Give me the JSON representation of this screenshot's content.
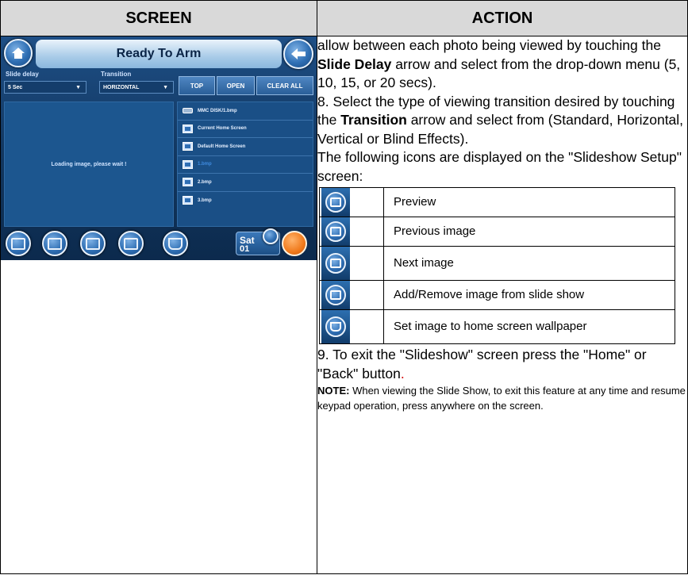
{
  "header": {
    "screen": "SCREEN",
    "action": "ACTION"
  },
  "device": {
    "title": "Ready To Arm",
    "slide_delay_label": "Slide delay",
    "slide_delay_value": "5 Sec",
    "transition_label": "Transition",
    "transition_value": "HORIZONTAL",
    "buttons": {
      "top": "TOP",
      "open": "OPEN",
      "clear_all": "CLEAR ALL"
    },
    "loading_text": "Loading image, please wait !",
    "files": [
      "MMC DISK/1.bmp",
      "Current Home Screen",
      "Default Home Screen",
      "1.bmp",
      "2.bmp",
      "3.bmp"
    ],
    "date": {
      "day": "Sat",
      "num": "01"
    },
    "colors": {
      "accent": "#2f6fb4",
      "panel": "#1a4f86",
      "home_button": "#f07a1c"
    }
  },
  "action": {
    "para1_a": "allow between each photo being viewed by touching the ",
    "para1_bold": "Slide Delay",
    "para1_b": " arrow and select from the drop-down menu (5, 10, 15, or 20 secs).",
    "para2_a": "8. Select the type of viewing transition desired by touching the ",
    "para2_bold": "Transition",
    "para2_b": " arrow and select from (Standard, Horizontal, Vertical or Blind Effects).",
    "para3": "The following icons are displayed on the \"Slideshow Setup\" screen:",
    "icons": [
      {
        "icon": "preview-icon",
        "label": "Preview"
      },
      {
        "icon": "previous-image-icon",
        "label": "Previous image"
      },
      {
        "icon": "next-image-icon",
        "label": "Next image"
      },
      {
        "icon": "add-remove-image-icon",
        "label": "Add/Remove image from slide show"
      },
      {
        "icon": "set-wallpaper-icon",
        "label": "Set image to home screen wallpaper"
      }
    ],
    "para4_a": "9. To exit the \"Slideshow\" screen press the \"Home\" or \"Back\" button",
    "para4_period": ".",
    "note_label": "NOTE:",
    "note_text": " When viewing the Slide Show, to exit this feature at any time and resume keypad operation, press anywhere on the screen."
  }
}
